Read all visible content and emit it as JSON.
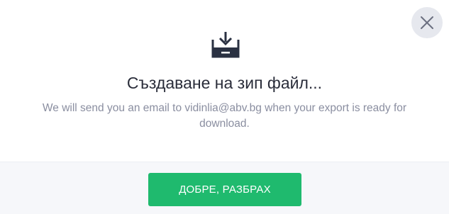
{
  "dialog": {
    "title": "Създаване на зип файл...",
    "message": "We will send you an email to vidinlia@abv.bg when your export is ready for download.",
    "icon": "download-tray-icon",
    "close_icon": "close-icon"
  },
  "footer": {
    "ok_label": "ДОБРЕ, РАЗБРАХ"
  },
  "colors": {
    "primary": "#1fba6e",
    "title_text": "#2a2d3a",
    "muted_text": "#8a8ea0",
    "close_bg": "#e6e8ee",
    "footer_bg": "#f6f7fa"
  }
}
